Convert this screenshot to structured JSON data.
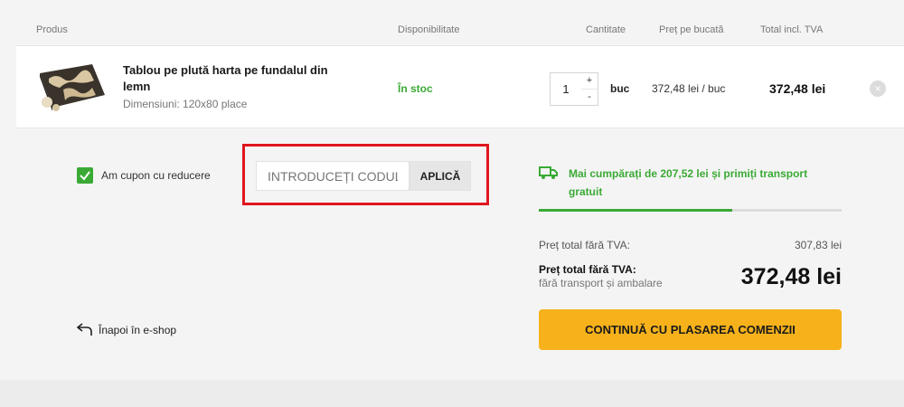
{
  "table_header": {
    "product": "Produs",
    "availability": "Disponibilitate",
    "quantity": "Cantitate",
    "unit_price": "Preț pe bucată",
    "total": "Total incl. TVA"
  },
  "cart_item": {
    "name": "Tablou pe plută harta pe fundalul din lemn",
    "dimensions": "Dimensiuni: 120x80 place",
    "stock": "În stoc",
    "quantity": "1",
    "qty_plus": "+",
    "qty_minus": "-",
    "unit": "buc",
    "unit_price": "372,48 lei / buc",
    "total_price": "372,48 lei",
    "remove": "×"
  },
  "coupon": {
    "checkbox_label": "Am cupon cu reducere",
    "checked": true,
    "input_placeholder": "INTRODUCEȚI CODUL",
    "apply_label": "APLICĂ"
  },
  "shipping": {
    "message": "Mai cumpărați de 207,52 lei și primiți transport gratuit",
    "progress_fraction": 0.64,
    "color": "#3aaa35"
  },
  "summary": {
    "net_label": "Preț total fără TVA:",
    "net_value": "307,83 lei",
    "gross_label": "Preț total fără TVA:",
    "gross_sub": "fără transport și ambalare",
    "gross_value": "372,48 lei"
  },
  "actions": {
    "continue_label": "CONTINUĂ CU PLASAREA COMENZII",
    "back_label": "Înapoi în e-shop"
  },
  "colors": {
    "accent_green": "#3aaa35",
    "cta_yellow": "#f7b21b",
    "highlight_red": "#e0161e"
  }
}
